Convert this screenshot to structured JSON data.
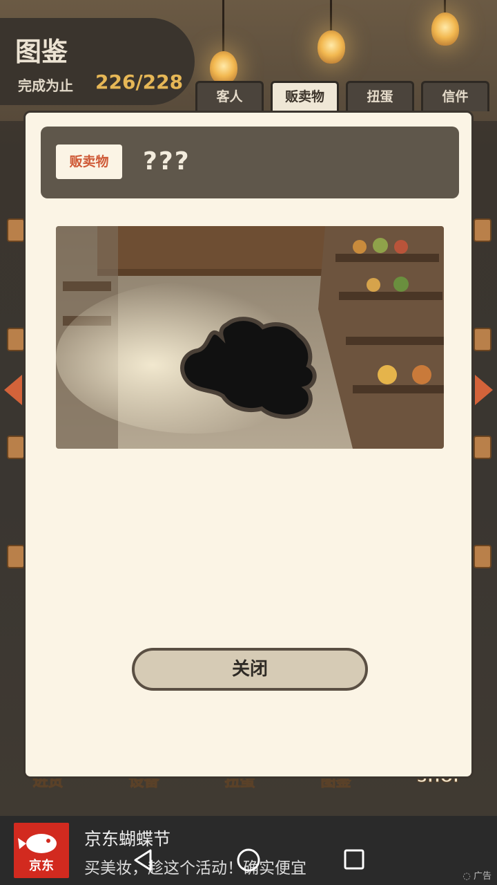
{
  "header": {
    "title": "图鉴",
    "progress_label": "完成为止",
    "progress_value": "226/228"
  },
  "tabs": [
    {
      "label": "客人",
      "active": false
    },
    {
      "label": "贩卖物",
      "active": true
    },
    {
      "label": "扭蛋",
      "active": false
    },
    {
      "label": "信件",
      "active": false
    }
  ],
  "bottom_nav": [
    "进货",
    "设备",
    "扭蛋",
    "图鉴",
    "SHOP"
  ],
  "modal": {
    "category": "贩卖物",
    "item_name": "???",
    "close_label": "关闭"
  },
  "ad": {
    "logo_text": "京东",
    "headline": "京东蝴蝶节",
    "subline": "买美妆，趁这个活动！确实便宜",
    "tag": "广告"
  },
  "colors": {
    "accent_red": "#cf5a37",
    "progress_gold": "#e6b756",
    "modal_bg": "#fbf4e5",
    "title_bar": "#5f574b"
  }
}
